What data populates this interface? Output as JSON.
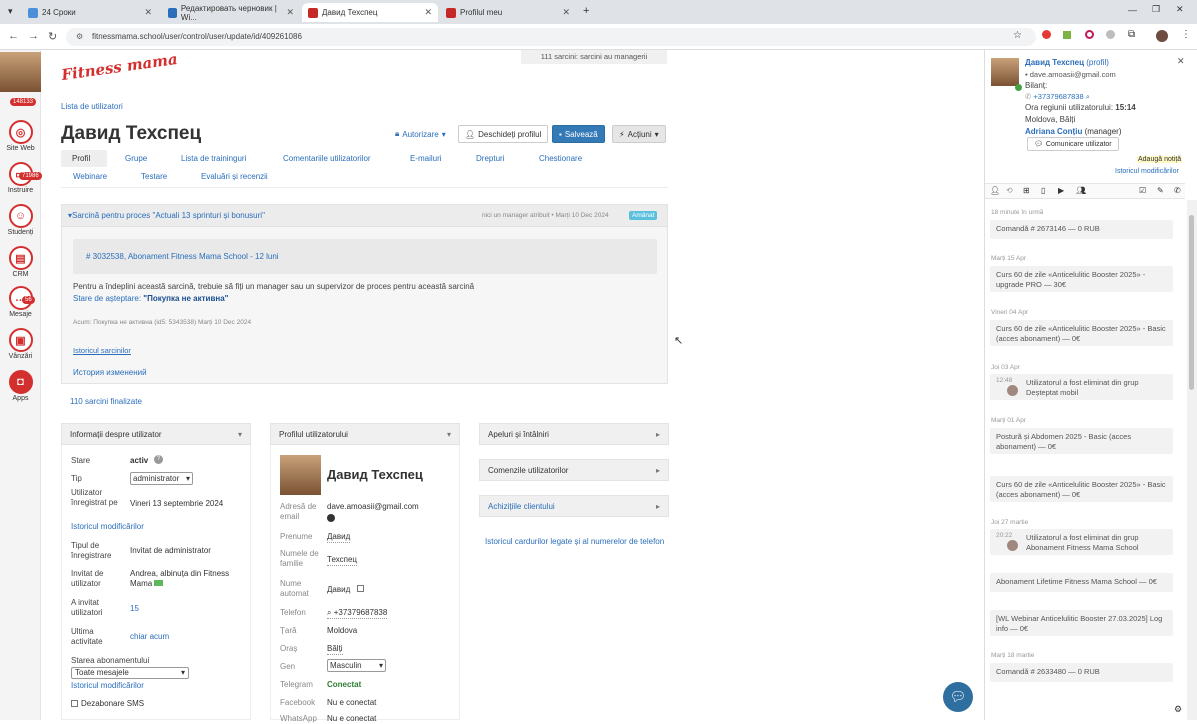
{
  "browser": {
    "tabs": [
      {
        "label": "24 Сроки",
        "color": "#4a90d9"
      },
      {
        "label": "Редактировать черновик | Wi...",
        "color": "#2a6ebb"
      },
      {
        "label": "Давид Техспец",
        "color": "#c62828"
      },
      {
        "label": "Profilul meu",
        "color": "#c62828"
      }
    ],
    "url": "fitnessmama.school/user/control/user/update/id/409261086"
  },
  "rail": {
    "items": [
      {
        "label": "",
        "badge": "148133"
      },
      {
        "label": "Site Web",
        "badge": ""
      },
      {
        "label": "Instruire",
        "badge": "71986"
      },
      {
        "label": "Studenți",
        "badge": ""
      },
      {
        "label": "CRM",
        "badge": ""
      },
      {
        "label": "Mesaje",
        "badge": "56"
      },
      {
        "label": "Vânzări",
        "badge": ""
      },
      {
        "label": "Apps",
        "badge": ""
      }
    ]
  },
  "main": {
    "logo": "Fitness mama",
    "top_note": "111 sarcini: sarcini au managerii",
    "breadcrumb": "Lista de utilizatori",
    "title": "Давид Техспец",
    "actions": {
      "authorize": "Autorizare",
      "open_profile": "Deschideți profilul",
      "save": "Salvează",
      "more": "Acțiuni"
    },
    "tabs": [
      "Profil",
      "Grupe",
      "Lista de traininguri",
      "Comentariile utilizatorilor",
      "E-mailuri",
      "Drepturi",
      "Chestionare",
      "Webinare",
      "Testare",
      "Evaluări și recenzii"
    ],
    "task": {
      "header": "Sarcină pentru proces \"Actuali 13 sprinturi și bonusuri\"",
      "meta": "nici un manager atribuit • Marți 10 Dec 2024",
      "status": "Amânat",
      "order": "# 3032538, Abonament Fitness Mama School - 12 luni",
      "text": "Pentru a îndeplini această sarcină, trebuie să fiți un manager sau un supervizor de proces pentru această sarcină",
      "wait_prefix": "Stare de așteptare:",
      "wait_value": "\"Покупка не активна\"",
      "small": "Acum: Покупка не активна (id5: 5343538) Marți 10 Dec 2024",
      "history": "Istoricul sarcinilor",
      "changes": "История изменений"
    },
    "finished": "110 sarcini finalizate",
    "info": {
      "title": "Informații despre utilizator",
      "state_l": "Stare",
      "state_v": "activ",
      "type_l": "Tip",
      "type_v": "administrator",
      "reg_l": "Utilizator înregistrat pe",
      "reg_v": "Vineri 13 septembrie 2024",
      "hist": "Istoricul modificărilor",
      "regtype_l": "Tipul de înregistrare",
      "regtype_v": "Invitat de administrator",
      "inv_l": "Invitat de utilizator",
      "inv_v": "Andrea, albinuța din Fitness Mama",
      "invited_l": "A invitat utilizatori",
      "invited_v": "15",
      "last_l": "Ultima activitate",
      "last_v": "chiar acum",
      "sub_l": "Starea abonamentului",
      "sub_v": "Toate mesajele",
      "hist2": "Istoricul modificărilor",
      "unsub": "Dezabonare SMS"
    },
    "profile": {
      "title": "Profilul utilizatorului",
      "name": "Давид Техспец",
      "email_l": "Adresă de email",
      "email_v": "dave.amoasii@gmail.com",
      "first_l": "Prenume",
      "first_v": "Давид",
      "last_l": "Numele de familie",
      "last_v": "Техспец",
      "auto_l": "Nume automat",
      "auto_v": "Давид",
      "phone_l": "Telefon",
      "phone_v": "+37379687838",
      "country_l": "Țară",
      "country_v": "Moldova",
      "city_l": "Oraș",
      "city_v": "Bălți",
      "gender_l": "Gen",
      "gender_v": "Masculin",
      "tg_l": "Telegram",
      "tg_v": "Conectat",
      "fb_l": "Facebook",
      "fb_v": "Nu e conectat",
      "wa_l": "WhatsApp",
      "wa_v": "Nu e conectat"
    },
    "side_panels": [
      "Apeluri și întâlniri",
      "Comenzile utilizatorilor",
      "Achizițiile clientului"
    ],
    "cards_link": "Istoricul cardurilor legate și al numerelor de telefon"
  },
  "right": {
    "name": "Давид Техспец",
    "profile_tag": "(profil)",
    "email": "dave.amoasii@gmail.com",
    "balance": "Bilanț:",
    "phone": "+37379687838",
    "region_time_label": "Ora regiunii utilizatorului:",
    "region_time": "15:14",
    "location": "Moldova, Bălți",
    "manager": "Adriana Conțiu",
    "manager_tag": "(manager)",
    "comm_btn": "Comunicare utilizator",
    "add_note": "Adaugă notiță",
    "history_link": "Istoricul modificărilor",
    "feed": [
      {
        "date": "18 minute în urmă",
        "text": "Comandă # 2673146 — 0 RUB"
      },
      {
        "date": "Marți 15 Apr",
        "text": "Curs 60 de zile «Anticelulitic Booster 2025» - upgrade PRO — 30€"
      },
      {
        "date": "Vineri 04 Apr",
        "text": "Curs 60 de zile «Anticelulitic Booster 2025» - Basic (acces abonament) — 0€"
      },
      {
        "date": "Joi 03 Apr",
        "text": "Utilizatorul a fost eliminat din grup Deșteptat mobil"
      },
      {
        "date": "Marți 01 Apr",
        "text": "Postură și Abdomen 2025 - Basic (acces abonament) — 0€"
      },
      {
        "date": "",
        "text": "Curs 60 de zile «Anticelulitic Booster 2025» - Basic (acces abonament) — 0€"
      },
      {
        "date": "Joi 27 martie",
        "text": "Utilizatorul a fost eliminat din grup Abonament Fitness Mama School"
      },
      {
        "date": "",
        "text": "Abonament Lifetime Fitness Mama School — 0€"
      },
      {
        "date": "",
        "text": "[WL Webinar Anticelulitic Booster 27.03.2025] Log info — 0€"
      },
      {
        "date": "Marți 18 martie",
        "text": "Comandă # 2633480 — 0 RUB"
      }
    ],
    "feed_times": [
      "12:48",
      "20:22"
    ]
  }
}
